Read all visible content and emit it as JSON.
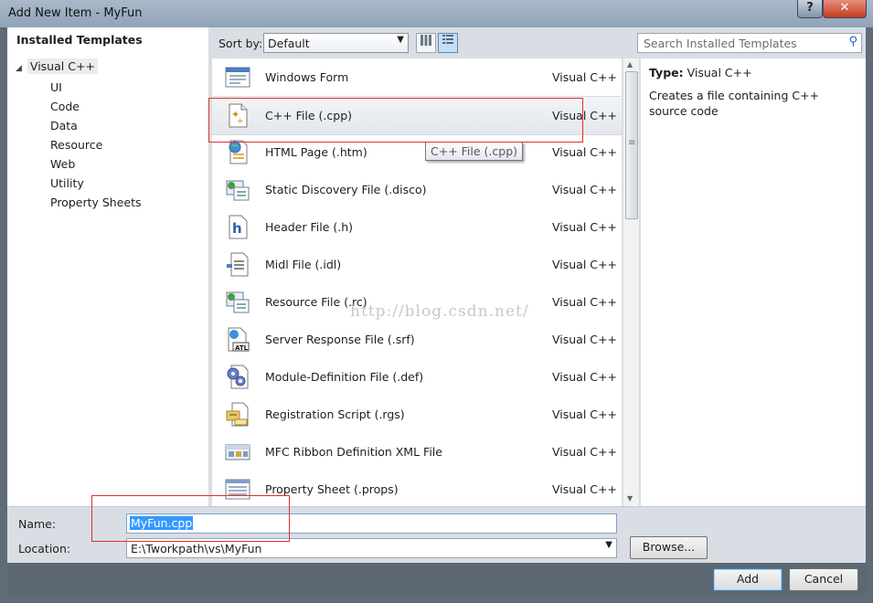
{
  "window": {
    "title": "Add New Item - MyFun",
    "help_label": "?",
    "close_label": "✕"
  },
  "left_panel": {
    "header": "Installed Templates",
    "root": "Visual C++",
    "children": [
      "UI",
      "Code",
      "Data",
      "Resource",
      "Web",
      "Utility",
      "Property Sheets"
    ]
  },
  "toolbar": {
    "sort_label": "Sort by:",
    "sort_value": "Default"
  },
  "search": {
    "placeholder": "Search Installed Templates"
  },
  "templates": [
    {
      "name": "Windows Form",
      "lang": "Visual C++",
      "icon": "windows-form-icon"
    },
    {
      "name": "C++ File (.cpp)",
      "lang": "Visual C++",
      "icon": "cpp-file-icon",
      "selected": true
    },
    {
      "name": "HTML Page (.htm)",
      "lang": "Visual C++",
      "icon": "html-page-icon"
    },
    {
      "name": "Static Discovery File (.disco)",
      "lang": "Visual C++",
      "icon": "discovery-file-icon"
    },
    {
      "name": "Header File (.h)",
      "lang": "Visual C++",
      "icon": "header-file-icon"
    },
    {
      "name": "Midl File (.idl)",
      "lang": "Visual C++",
      "icon": "midl-file-icon"
    },
    {
      "name": "Resource File (.rc)",
      "lang": "Visual C++",
      "icon": "resource-file-icon"
    },
    {
      "name": "Server Response File (.srf)",
      "lang": "Visual C++",
      "icon": "server-response-file-icon"
    },
    {
      "name": "Module-Definition File (.def)",
      "lang": "Visual C++",
      "icon": "module-definition-file-icon"
    },
    {
      "name": "Registration Script (.rgs)",
      "lang": "Visual C++",
      "icon": "registration-script-icon"
    },
    {
      "name": "MFC Ribbon Definition XML File",
      "lang": "Visual C++",
      "icon": "ribbon-xml-icon"
    },
    {
      "name": "Property Sheet (.props)",
      "lang": "Visual C++",
      "icon": "property-sheet-icon"
    }
  ],
  "tooltip": "C++ File (.cpp)",
  "details": {
    "type_label": "Type:",
    "type_value": "Visual C++",
    "description": "Creates a file containing C++ source code"
  },
  "form": {
    "name_label": "Name:",
    "name_value": "MyFun.cpp",
    "location_label": "Location:",
    "location_value": "E:\\Tworkpath\\vs\\MyFun",
    "browse_label": "Browse..."
  },
  "buttons": {
    "add": "Add",
    "cancel": "Cancel"
  },
  "watermark": "http://blog.csdn.net/",
  "colors": {
    "selection": "#3399ff",
    "annotation_red": "#e0302a"
  }
}
